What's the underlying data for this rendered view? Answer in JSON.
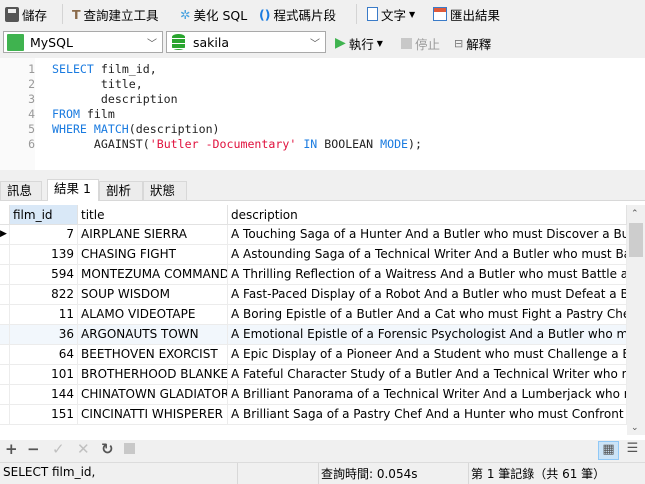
{
  "toolbar": {
    "save": "儲存",
    "query_builder": "查詢建立工具",
    "beautify": "美化 SQL",
    "snippet": "程式碼片段",
    "text": "文字",
    "export": "匯出結果",
    "run": "執行",
    "stop": "停止",
    "explain": "解釋"
  },
  "connection": {
    "value": "MySQL"
  },
  "database": {
    "value": "sakila"
  },
  "editor": {
    "lines": [
      {
        "n": "1",
        "tokens": [
          {
            "t": "SELECT ",
            "c": "kw"
          },
          {
            "t": "film_id,",
            "c": "pl"
          }
        ]
      },
      {
        "n": "2",
        "tokens": [
          {
            "t": "       title,",
            "c": "pl"
          }
        ]
      },
      {
        "n": "3",
        "tokens": [
          {
            "t": "       description",
            "c": "pl"
          }
        ]
      },
      {
        "n": "4",
        "tokens": [
          {
            "t": "FROM ",
            "c": "kw"
          },
          {
            "t": "film",
            "c": "pl"
          }
        ]
      },
      {
        "n": "5",
        "tokens": [
          {
            "t": "WHERE ",
            "c": "kw"
          },
          {
            "t": "MATCH",
            "c": "kw"
          },
          {
            "t": "(description)",
            "c": "pl"
          }
        ]
      },
      {
        "n": "6",
        "tokens": [
          {
            "t": "      AGAINST(",
            "c": "pl"
          },
          {
            "t": "'Butler -Documentary'",
            "c": "str"
          },
          {
            "t": " ",
            "c": "pl"
          },
          {
            "t": "IN",
            "c": "kw"
          },
          {
            "t": " BOOLEAN ",
            "c": "pl"
          },
          {
            "t": "MODE",
            "c": "kw"
          },
          {
            "t": ");",
            "c": "pl"
          }
        ]
      }
    ]
  },
  "tabs": [
    "訊息",
    "結果 1",
    "剖析",
    "狀態"
  ],
  "active_tab": 1,
  "grid": {
    "columns": [
      "film_id",
      "title",
      "description"
    ],
    "rows": [
      [
        "7",
        "AIRPLANE SIERRA",
        "A Touching Saga of a Hunter And a Butler who must Discover a Butler in A"
      ],
      [
        "139",
        "CHASING FIGHT",
        "A Astounding Saga of a Technical Writer And a Butler who must Battle a Bu"
      ],
      [
        "594",
        "MONTEZUMA COMMAND",
        "A Thrilling Reflection of a Waitress And a Butler who must Battle a Butler in"
      ],
      [
        "822",
        "SOUP WISDOM",
        "A Fast-Paced Display of a Robot And a Butler who must Defeat a Butler in A"
      ],
      [
        "11",
        "ALAMO VIDEOTAPE",
        "A Boring Epistle of a Butler And a Cat who must Fight a Pastry Chef in A My"
      ],
      [
        "36",
        "ARGONAUTS TOWN",
        "A Emotional Epistle of a Forensic Psychologist And a Butler who must Chal"
      ],
      [
        "64",
        "BEETHOVEN EXORCIST",
        "A Epic Display of a Pioneer And a Student who must Challenge a Butler in T"
      ],
      [
        "101",
        "BROTHERHOOD BLANKET",
        "A Fateful Character Study of a Butler And a Technical Writer who must Sink"
      ],
      [
        "144",
        "CHINATOWN GLADIATOR",
        "A Brilliant Panorama of a Technical Writer And a Lumberjack who must Esc"
      ],
      [
        "151",
        "CINCINATTI WHISPERER",
        "A Brilliant Saga of a Pastry Chef And a Hunter who must Confront a Butler i"
      ]
    ]
  },
  "status": {
    "sql": "SELECT film_id,",
    "query_time": "查詢時間: 0.054s",
    "record": "第 1 筆記錄（共 61 筆）"
  }
}
